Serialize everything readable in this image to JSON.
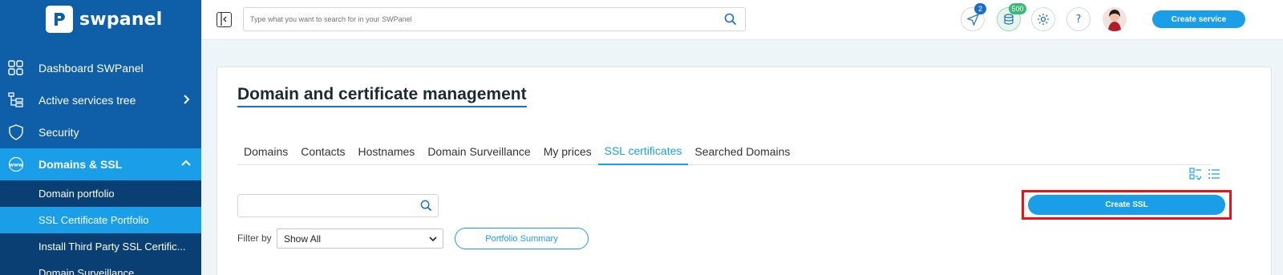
{
  "brand": {
    "name": "swpanel"
  },
  "sidebar": {
    "items": [
      {
        "label": "Dashboard SWPanel"
      },
      {
        "label": "Active services tree"
      },
      {
        "label": "Security"
      },
      {
        "label": "Domains & SSL"
      }
    ],
    "subitems": [
      {
        "label": "Domain portfolio"
      },
      {
        "label": "SSL Certificate Portfolio"
      },
      {
        "label": "Install Third Party SSL Certific..."
      },
      {
        "label": "Domain Surveillance"
      }
    ]
  },
  "topbar": {
    "search_placeholder": "Type what you want to search for in your SWPanel",
    "notifications_badge": "2",
    "credits_badge": "500",
    "create_service_label": "Create service"
  },
  "main": {
    "title": "Domain and certificate management",
    "tabs": [
      {
        "label": "Domains"
      },
      {
        "label": "Contacts"
      },
      {
        "label": "Hostnames"
      },
      {
        "label": "Domain Surveillance"
      },
      {
        "label": "My prices"
      },
      {
        "label": "SSL certificates"
      },
      {
        "label": "Searched Domains"
      }
    ],
    "active_tab": "SSL certificates",
    "filter_label": "Filter by",
    "filter_value": "Show All",
    "portfolio_summary_label": "Portfolio Summary",
    "create_ssl_label": "Create SSL"
  },
  "colors": {
    "sidebar_bg": "#0f5fa8",
    "accent": "#1a9ee8",
    "highlight_box": "#e8141c"
  }
}
